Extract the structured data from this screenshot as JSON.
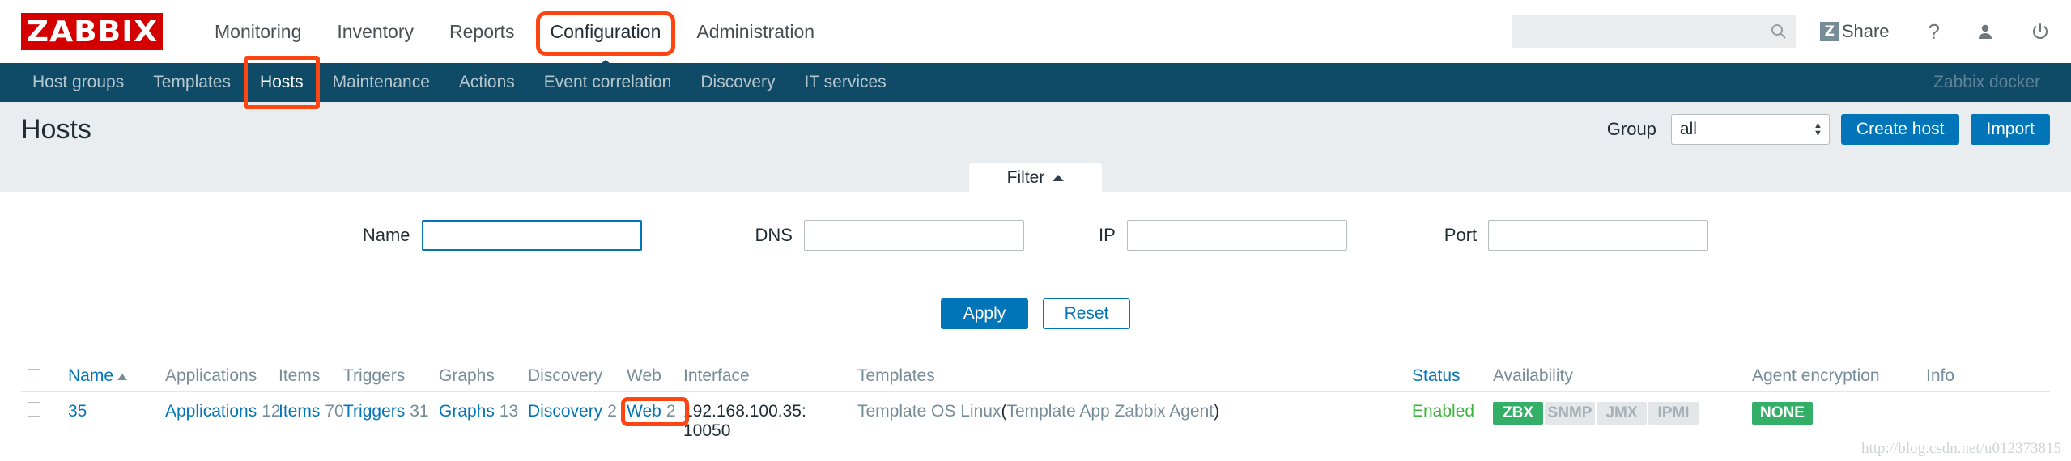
{
  "brand": {
    "logo_text": "ZABBIX",
    "logo_color": "#d40000"
  },
  "header": {
    "nav": [
      {
        "label": "Monitoring",
        "active": false
      },
      {
        "label": "Inventory",
        "active": false
      },
      {
        "label": "Reports",
        "active": false
      },
      {
        "label": "Configuration",
        "active": true
      },
      {
        "label": "Administration",
        "active": false
      }
    ],
    "search": {
      "value": "",
      "placeholder": "",
      "icon": "search-icon"
    },
    "share": {
      "label": "Share",
      "badge": "Z"
    },
    "help_icon": "?",
    "user_icon": "user-icon",
    "power_icon": "power-icon"
  },
  "subnav": {
    "items": [
      {
        "label": "Host groups",
        "active": false
      },
      {
        "label": "Templates",
        "active": false
      },
      {
        "label": "Hosts",
        "active": true
      },
      {
        "label": "Maintenance",
        "active": false
      },
      {
        "label": "Actions",
        "active": false
      },
      {
        "label": "Event correlation",
        "active": false
      },
      {
        "label": "Discovery",
        "active": false
      },
      {
        "label": "IT services",
        "active": false
      }
    ],
    "user": "Zabbix docker"
  },
  "page": {
    "title": "Hosts",
    "group_label": "Group",
    "group_value": "all",
    "create_host_label": "Create host",
    "import_label": "Import"
  },
  "filter": {
    "tab_label": "Filter",
    "fields": [
      {
        "label": "Name",
        "value": "",
        "focused": true
      },
      {
        "label": "DNS",
        "value": "",
        "focused": false
      },
      {
        "label": "IP",
        "value": "",
        "focused": false
      },
      {
        "label": "Port",
        "value": "",
        "focused": false
      }
    ],
    "apply_label": "Apply",
    "reset_label": "Reset"
  },
  "table": {
    "headers": {
      "name": "Name",
      "applications": "Applications",
      "items": "Items",
      "triggers": "Triggers",
      "graphs": "Graphs",
      "discovery": "Discovery",
      "web": "Web",
      "interface": "Interface",
      "templates": "Templates",
      "status": "Status",
      "availability": "Availability",
      "agent_encryption": "Agent encryption",
      "info": "Info"
    },
    "sort_column": "Name",
    "sort_direction": "asc",
    "rows": [
      {
        "name": "35",
        "applications_label": "Applications",
        "applications_count": "12",
        "items_label": "Items",
        "items_count": "70",
        "triggers_label": "Triggers",
        "triggers_count": "31",
        "graphs_label": "Graphs",
        "graphs_count": "13",
        "discovery_label": "Discovery",
        "discovery_count": "2",
        "web_label": "Web",
        "web_count": "2",
        "interface_host": "192.168.100.35:",
        "interface_port": "10050",
        "template_main": "Template OS Linux",
        "template_paren_open": "(",
        "template_sub": "Template App Zabbix Agent",
        "template_paren_close": ")",
        "status": "Enabled",
        "availability": [
          {
            "label": "ZBX",
            "on": true
          },
          {
            "label": "SNMP",
            "on": false
          },
          {
            "label": "JMX",
            "on": false
          },
          {
            "label": "IPMI",
            "on": false
          }
        ],
        "encryption": "NONE",
        "info": ""
      }
    ]
  },
  "watermark": "http://blog.csdn.net/u012373815",
  "colors": {
    "brand_red": "#d40000",
    "subnav_bg": "#0f4b66",
    "link_blue": "#0275b8",
    "highlight_orange": "#ff4612",
    "status_green": "#3db43d",
    "badge_green": "#34af67"
  }
}
